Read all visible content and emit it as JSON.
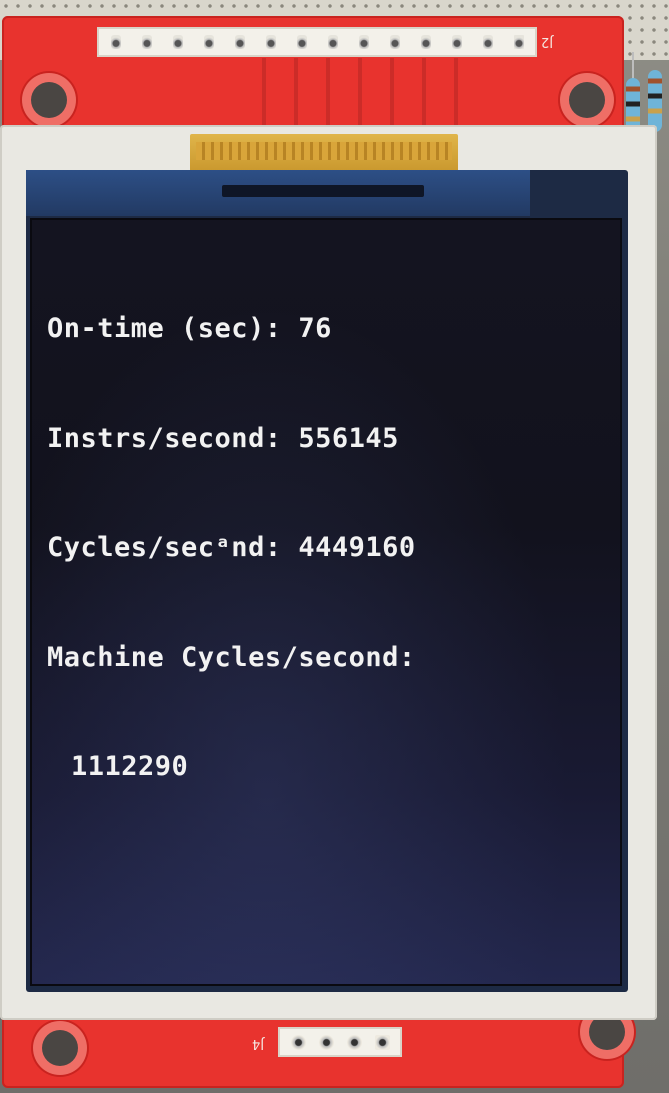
{
  "screen": {
    "lines": [
      "On-time (sec): 76",
      "Instrs/second: 556145",
      "Cycles/secᵃnd: 4449160",
      "Machine Cycles/second:",
      "1112290"
    ]
  },
  "board": {
    "header_label": "J2",
    "bottom_connector_label": "J4",
    "colors": {
      "pcb": "#e8332e",
      "frame": "#e9e8e2",
      "screen_background": "#141420",
      "screen_text": "#f2f2f2"
    }
  }
}
